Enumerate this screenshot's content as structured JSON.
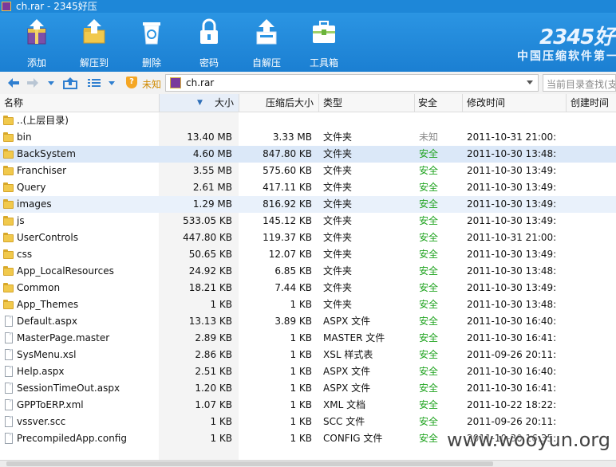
{
  "window": {
    "title": "ch.rar - 2345好压"
  },
  "toolbar": {
    "items": [
      {
        "label": "添加",
        "icon": "add-archive-icon"
      },
      {
        "label": "解压到",
        "icon": "extract-to-icon"
      },
      {
        "label": "删除",
        "icon": "delete-icon"
      },
      {
        "label": "密码",
        "icon": "password-lock-icon"
      },
      {
        "label": "自解压",
        "icon": "self-extract-icon"
      },
      {
        "label": "工具箱",
        "icon": "toolbox-icon"
      }
    ],
    "brand": "2345好",
    "slogan": "中国压缩软件第一"
  },
  "nav": {
    "security_status": "未知",
    "address": "ch.rar",
    "search_placeholder": "当前目录查找(支"
  },
  "columns": [
    "名称",
    "大小",
    "压缩后大小",
    "类型",
    "安全",
    "修改时间",
    "创建时间"
  ],
  "files": [
    {
      "name": "..(上层目录)",
      "size": "",
      "packed": "",
      "type": "",
      "safety": "",
      "modified": "",
      "kind": "folder"
    },
    {
      "name": "bin",
      "size": "13.40 MB",
      "packed": "3.33 MB",
      "type": "文件夹",
      "safety": "未知",
      "modified": "2011-10-31 21:00:",
      "kind": "folder"
    },
    {
      "name": "BackSystem",
      "size": "4.60 MB",
      "packed": "847.80 KB",
      "type": "文件夹",
      "safety": "安全",
      "modified": "2011-10-30 13:48:",
      "kind": "folder"
    },
    {
      "name": "Franchiser",
      "size": "3.55 MB",
      "packed": "575.60 KB",
      "type": "文件夹",
      "safety": "安全",
      "modified": "2011-10-30 13:49:",
      "kind": "folder"
    },
    {
      "name": "Query",
      "size": "2.61 MB",
      "packed": "417.11 KB",
      "type": "文件夹",
      "safety": "安全",
      "modified": "2011-10-30 13:49:",
      "kind": "folder"
    },
    {
      "name": "images",
      "size": "1.29 MB",
      "packed": "816.92 KB",
      "type": "文件夹",
      "safety": "安全",
      "modified": "2011-10-30 13:49:",
      "kind": "folder"
    },
    {
      "name": "js",
      "size": "533.05 KB",
      "packed": "145.12 KB",
      "type": "文件夹",
      "safety": "安全",
      "modified": "2011-10-30 13:49:",
      "kind": "folder"
    },
    {
      "name": "UserControls",
      "size": "447.80 KB",
      "packed": "119.37 KB",
      "type": "文件夹",
      "safety": "安全",
      "modified": "2011-10-31 21:00:",
      "kind": "folder"
    },
    {
      "name": "css",
      "size": "50.65 KB",
      "packed": "12.07 KB",
      "type": "文件夹",
      "safety": "安全",
      "modified": "2011-10-30 13:49:",
      "kind": "folder"
    },
    {
      "name": "App_LocalResources",
      "size": "24.92 KB",
      "packed": "6.85 KB",
      "type": "文件夹",
      "safety": "安全",
      "modified": "2011-10-30 13:48:",
      "kind": "folder"
    },
    {
      "name": "Common",
      "size": "18.21 KB",
      "packed": "7.44 KB",
      "type": "文件夹",
      "safety": "安全",
      "modified": "2011-10-30 13:49:",
      "kind": "folder"
    },
    {
      "name": "App_Themes",
      "size": "1 KB",
      "packed": "1 KB",
      "type": "文件夹",
      "safety": "安全",
      "modified": "2011-10-30 13:48:",
      "kind": "folder"
    },
    {
      "name": "Default.aspx",
      "size": "13.13 KB",
      "packed": "3.89 KB",
      "type": "ASPX 文件",
      "safety": "安全",
      "modified": "2011-10-30 16:40:",
      "kind": "file"
    },
    {
      "name": "MasterPage.master",
      "size": "2.89 KB",
      "packed": "1 KB",
      "type": "MASTER 文件",
      "safety": "安全",
      "modified": "2011-10-30 16:41:",
      "kind": "file"
    },
    {
      "name": "SysMenu.xsl",
      "size": "2.86 KB",
      "packed": "1 KB",
      "type": "XSL 样式表",
      "safety": "安全",
      "modified": "2011-09-26 20:11:",
      "kind": "file"
    },
    {
      "name": "Help.aspx",
      "size": "2.51 KB",
      "packed": "1 KB",
      "type": "ASPX 文件",
      "safety": "安全",
      "modified": "2011-10-30 16:40:",
      "kind": "file"
    },
    {
      "name": "SessionTimeOut.aspx",
      "size": "1.20 KB",
      "packed": "1 KB",
      "type": "ASPX 文件",
      "safety": "安全",
      "modified": "2011-10-30 16:41:",
      "kind": "file"
    },
    {
      "name": "GPPToERP.xml",
      "size": "1.07 KB",
      "packed": "1 KB",
      "type": "XML 文档",
      "safety": "安全",
      "modified": "2011-10-22 18:22:",
      "kind": "file"
    },
    {
      "name": "vssver.scc",
      "size": "1 KB",
      "packed": "1 KB",
      "type": "SCC 文件",
      "safety": "安全",
      "modified": "2011-09-26 20:11:",
      "kind": "file"
    },
    {
      "name": "PrecompiledApp.config",
      "size": "1 KB",
      "packed": "1 KB",
      "type": "CONFIG 文件",
      "safety": "安全",
      "modified": "2011-10-30 16:35:",
      "kind": "file"
    }
  ],
  "selected_row": "BackSystem",
  "hover_row": "images",
  "watermark": "www.wooyun.org",
  "colors": {
    "ribbon": "#1e87d8",
    "safe": "#1fa31f",
    "selection": "#dbe8f8"
  }
}
